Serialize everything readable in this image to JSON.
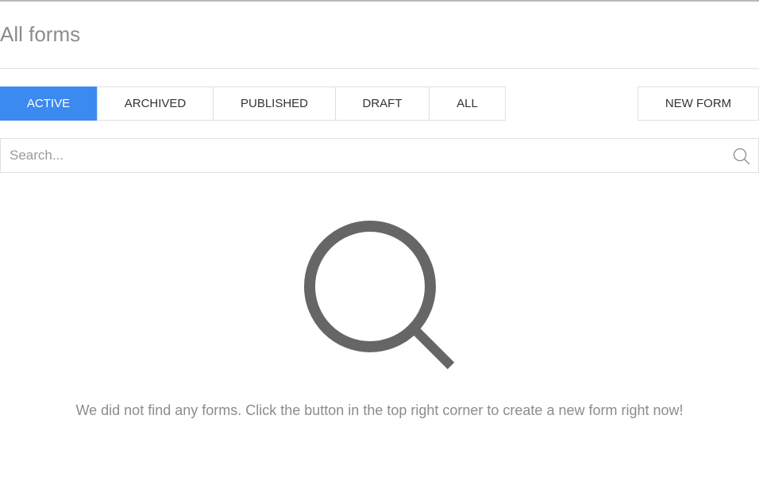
{
  "header": {
    "title": "All forms"
  },
  "filters": {
    "tabs": [
      {
        "label": "ACTIVE",
        "active": true
      },
      {
        "label": "ARCHIVED",
        "active": false
      },
      {
        "label": "PUBLISHED",
        "active": false
      },
      {
        "label": "DRAFT",
        "active": false
      },
      {
        "label": "ALL",
        "active": false
      }
    ]
  },
  "toolbar": {
    "new_form_label": "NEW FORM"
  },
  "search": {
    "value": "",
    "placeholder": "Search...",
    "icon": "search-icon"
  },
  "empty_state": {
    "icon": "magnifier-icon",
    "message": "We did not find any forms. Click the button in the top right corner to create a new form right now!"
  },
  "colors": {
    "accent": "#3b8af0",
    "muted_text": "#8c8c8c",
    "icon_gray": "#666666",
    "border": "#e0e0e0"
  }
}
